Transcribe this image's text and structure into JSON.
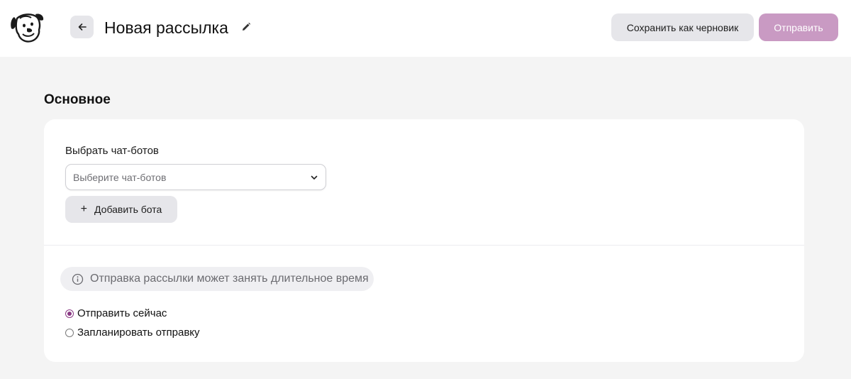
{
  "header": {
    "logo_icon": "dog-logo-icon",
    "back_icon": "arrow-left-icon",
    "title": "Новая рассылка",
    "edit_icon": "pencil-icon",
    "save_draft_label": "Сохранить как черновик",
    "send_label": "Отправить",
    "send_color": "#c99ac3"
  },
  "main": {
    "section_title": "Основное",
    "bots": {
      "label": "Выбрать чат-ботов",
      "placeholder": "Выберите чат-ботов",
      "chevron_icon": "chevron-down-icon",
      "add_bot_label": "Добавить бота",
      "add_icon": "plus-icon"
    },
    "notice": {
      "icon": "info-icon",
      "text": "Отправка рассылки может занять длительное время"
    },
    "schedule": {
      "options": [
        {
          "label": "Отправить сейчас",
          "checked": true
        },
        {
          "label": "Запланировать отправку",
          "checked": false
        }
      ],
      "accent_color": "#8a3a84"
    }
  }
}
